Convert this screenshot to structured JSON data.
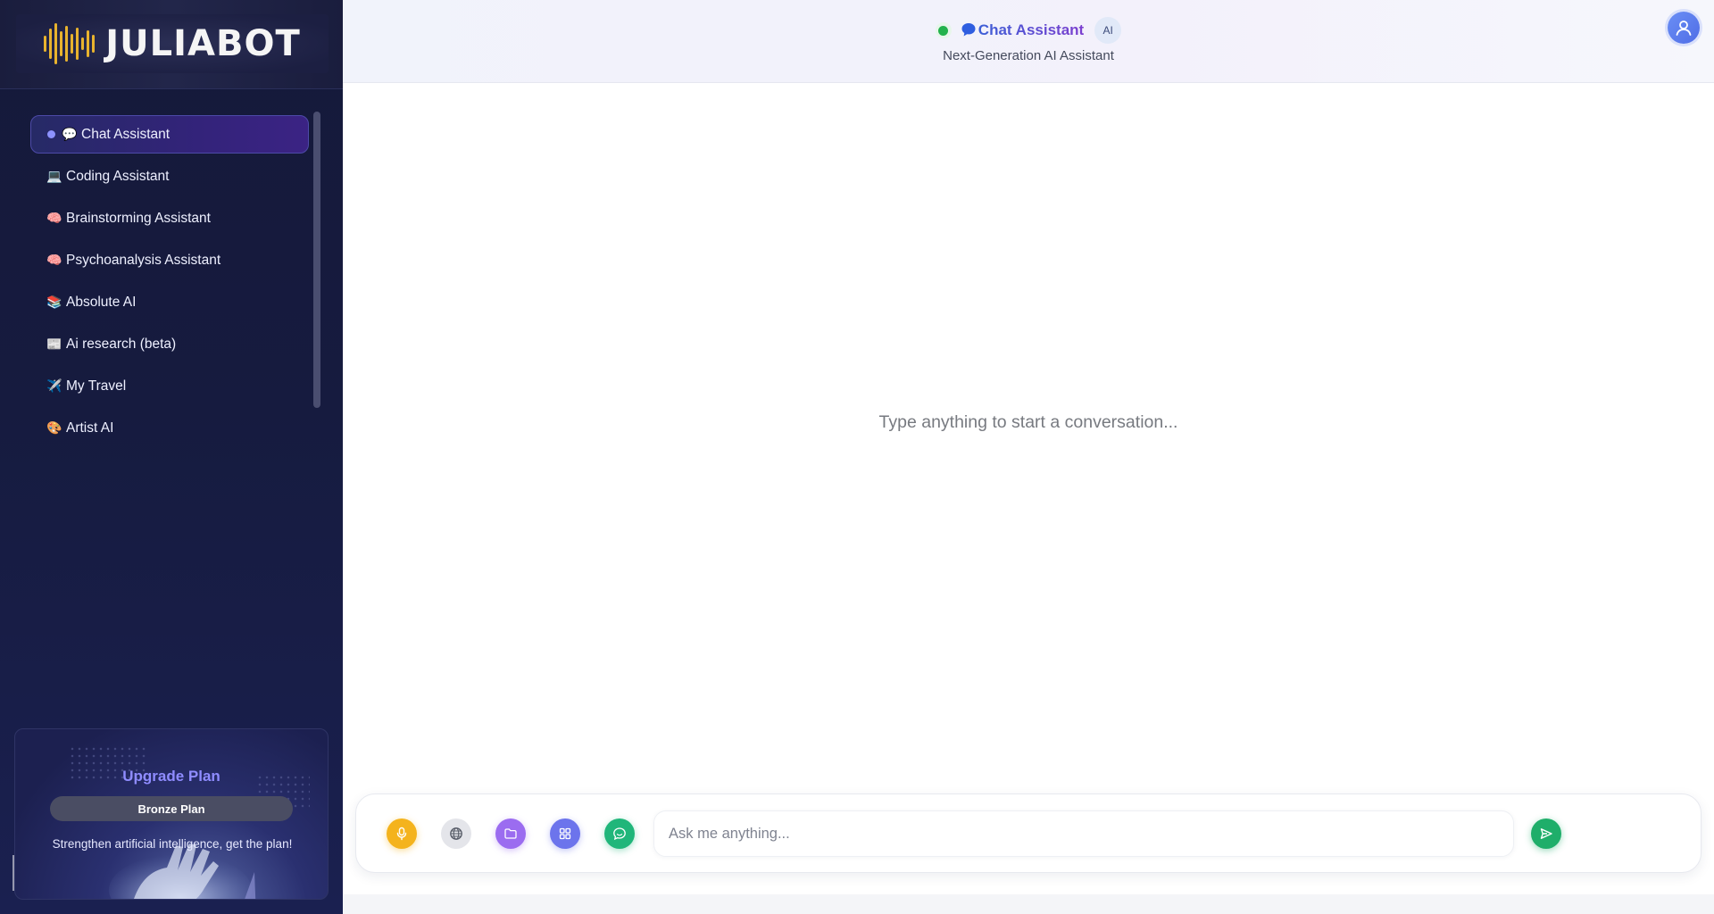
{
  "app": {
    "logo_text": "JULIABOT"
  },
  "sidebar": {
    "items": [
      {
        "emoji": "💬",
        "label": "Chat Assistant",
        "active": true
      },
      {
        "emoji": "💻",
        "label": "Coding Assistant"
      },
      {
        "emoji": "🧠",
        "label": "Brainstorming Assistant"
      },
      {
        "emoji": "🧠",
        "label": "Psychoanalysis Assistant"
      },
      {
        "emoji": "📚",
        "label": "Absolute AI"
      },
      {
        "emoji": "📰",
        "label": "Ai research (beta)"
      },
      {
        "emoji": "✈️",
        "label": "My Travel"
      },
      {
        "emoji": "🎨",
        "label": "Artist AI"
      }
    ],
    "upgrade": {
      "title": "Upgrade Plan",
      "plan": "Bronze Plan",
      "description": "Strengthen artificial intelligence, get the plan!"
    }
  },
  "header": {
    "title": "Chat Assistant",
    "badge": "AI",
    "subtitle": "Next-Generation AI Assistant",
    "status_color": "#22b24c"
  },
  "main": {
    "empty_message": "Type anything to start a conversation..."
  },
  "composer": {
    "placeholder": "Ask me anything...",
    "value": "",
    "tools": [
      "microphone-icon",
      "globe-icon",
      "folder-icon",
      "grid-icon",
      "message-icon"
    ],
    "send_icon": "send-icon"
  },
  "colors": {
    "sidebar_bg": "#15193a",
    "accent_purple": "#8f8cff",
    "mic": "#f4b31d",
    "folder": "#9b6cf0",
    "grid": "#6c74ec",
    "message": "#20b67a",
    "send": "#1fae6a"
  }
}
